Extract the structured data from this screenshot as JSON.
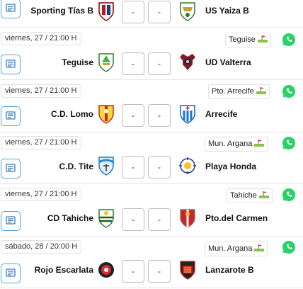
{
  "score_placeholder": "-",
  "matches": [
    {
      "home": "Sporting Tías B",
      "away": "US Yaiza B",
      "date": "",
      "venue": "",
      "home_crest_icon": "sporting-tias-crest-icon",
      "away_crest_icon": "us-yaiza-crest-icon"
    },
    {
      "home": "Teguise",
      "away": "UD Valterra",
      "date": "viernes, 27 / 21:00 H",
      "venue": "Teguise",
      "home_crest_icon": "teguise-crest-icon",
      "away_crest_icon": "ud-valterra-crest-icon"
    },
    {
      "home": "C.D. Lomo",
      "away": "Arrecife",
      "date": "viernes, 27 / 21:00 H",
      "venue": "Pto. Arrecife",
      "home_crest_icon": "cd-lomo-crest-icon",
      "away_crest_icon": "arrecife-crest-icon"
    },
    {
      "home": "C.D. Tite",
      "away": "Playa Honda",
      "date": "viernes, 27 / 21:00 H",
      "venue": "Mun. Argana",
      "home_crest_icon": "cd-tite-crest-icon",
      "away_crest_icon": "playa-honda-crest-icon"
    },
    {
      "home": "CD Tahiche",
      "away": "Pto.del Carmen",
      "date": "viernes, 27 / 21:00 H",
      "venue": "Tahiche",
      "home_crest_icon": "cd-tahiche-crest-icon",
      "away_crest_icon": "pto-del-carmen-crest-icon"
    },
    {
      "home": "Rojo Escarlata",
      "away": "Lanzarote B",
      "date": "sábado, 28 / 20:00 H",
      "venue": "Mun. Argana",
      "home_crest_icon": "rojo-escarlata-crest-icon",
      "away_crest_icon": "lanzarote-b-crest-icon"
    }
  ],
  "icons": {
    "note": "note-icon",
    "field": "soccer-field-icon",
    "whatsapp": "whatsapp-icon"
  },
  "colors": {
    "accent": "#5aa2d6",
    "whatsapp": "#25d366",
    "border": "#bdbdbd"
  }
}
